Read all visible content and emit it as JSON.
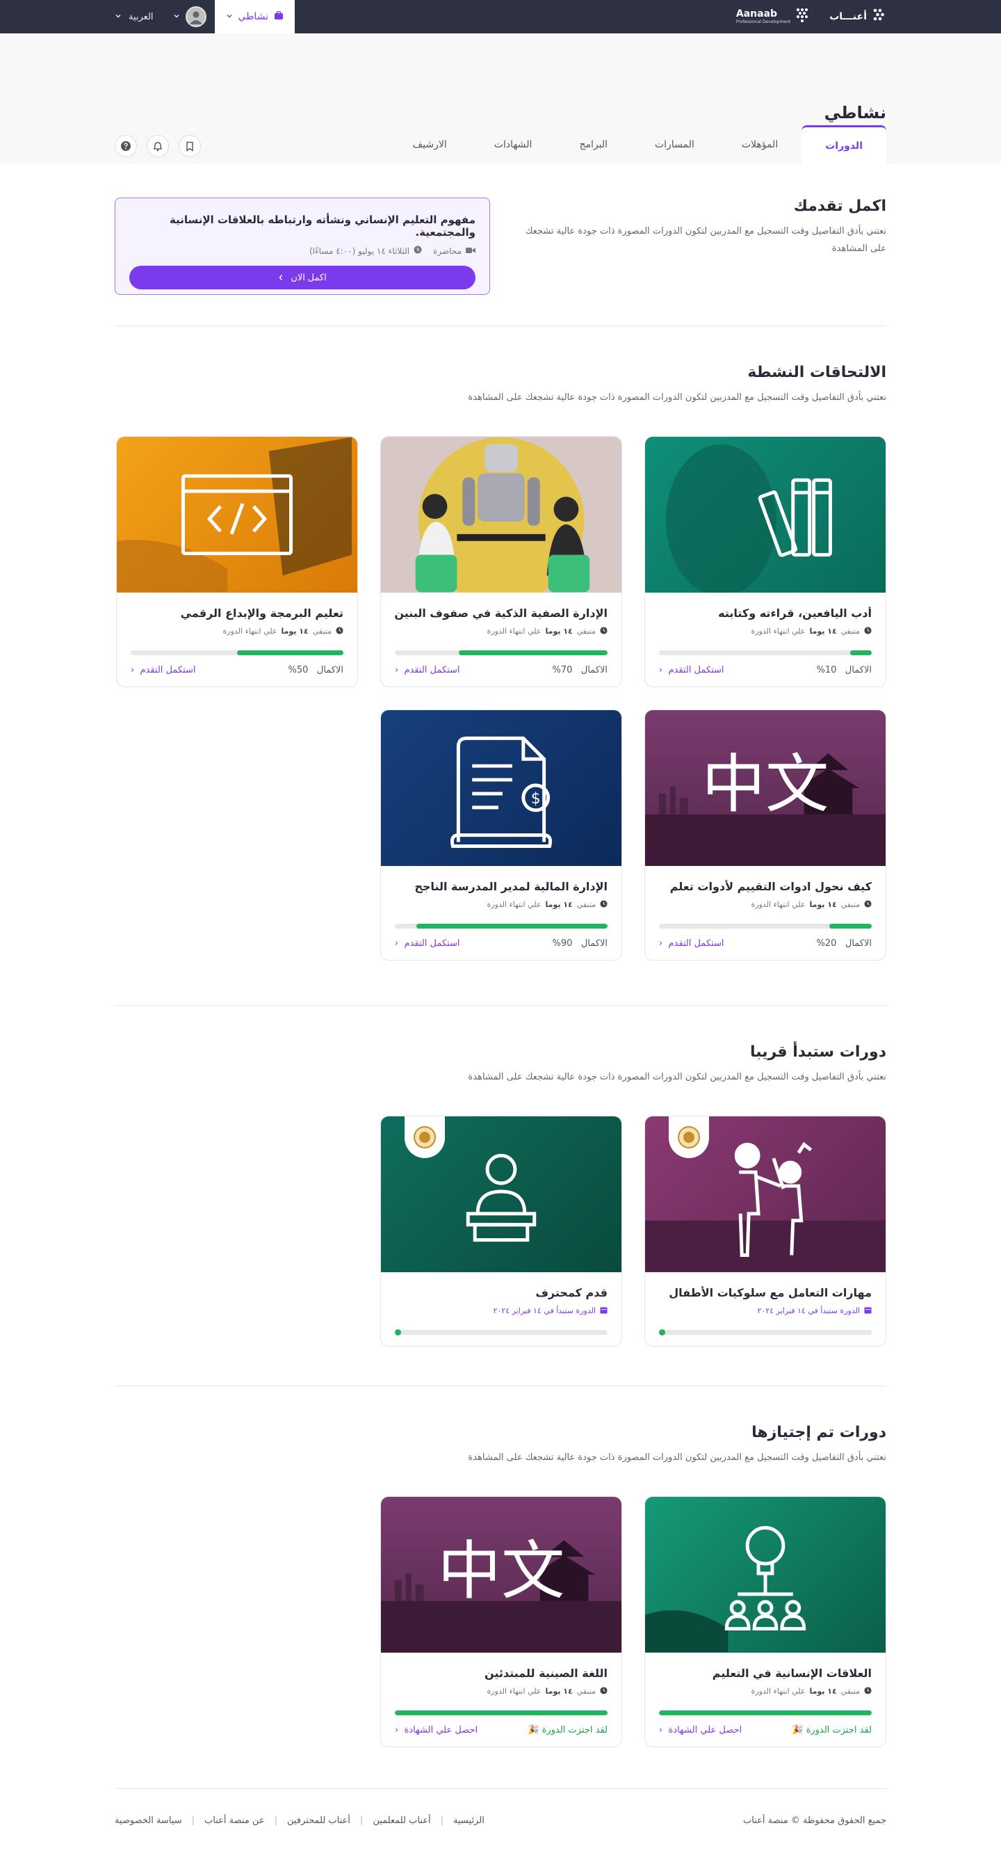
{
  "topbar": {
    "language": "العربية",
    "my_activity": "نشاطي",
    "brand_primary": "Aanaab",
    "brand_primary_sub": "Professional Development",
    "brand_secondary": "أعنـــاب"
  },
  "header": {
    "title": "نشاطي",
    "tabs": [
      "الدورات",
      "المؤهلات",
      "المسارات",
      "البرامج",
      "الشهادات",
      "الارشيف"
    ]
  },
  "progress": {
    "title": "اكمل تقدمك",
    "desc": "نعتني بأدق التفاصيل وقت التسجيل مع المدربين لتكون الدورات المصورة ذات جودة عالية تشجعك على المشاهدة",
    "card_title": "مفهوم التعليم الإنساني ونشأته وارتباطه بالعلاقات الإنسانية والمجتمعية.",
    "card_type": "محاضرة",
    "card_time": "الثلاثاء ١٤ يوليو (٤:٠٠ مساءًا)",
    "card_button": "اكمل الان"
  },
  "active": {
    "title": "الالتحاقات النشطة",
    "desc": "نعتني بأدق التفاصيل وقت التسجيل مع المدربين لتكون الدورات المصورة ذات جودة عالية تشجعك على المشاهدة",
    "remaining_prefix": "متبقي",
    "remaining_days": "١٤ يوما",
    "remaining_suffix": "علي انتهاء الدورة",
    "completion_label": "الاكمال",
    "continue_label": "استكمل التقدم",
    "courses": [
      {
        "title": "أدب اليافعين، قراءته وكتابته",
        "percent": "10%",
        "progress": 0.1
      },
      {
        "title": "الإدارة الصفية الذكية في صفوف البنين ...",
        "percent": "70%",
        "progress": 0.7
      },
      {
        "title": "تعليم البرمجة والإبداع الرقمي",
        "percent": "50%",
        "progress": 0.5
      },
      {
        "title": "كيف نحول ادوات التقييم لأدوات تعلم",
        "percent": "20%",
        "progress": 0.2
      },
      {
        "title": "الإدارة المالية لمدير المدرسة الناجح",
        "percent": "90%",
        "progress": 0.9
      }
    ]
  },
  "upcoming": {
    "title": "دورات ستبدأ قريبا",
    "desc": "نعتني بأدق التفاصيل وقت التسجيل مع المدربين لتكون الدورات المصورة ذات جودة عالية تشجعك على المشاهدة",
    "start_label": "الدورة ستبدأ في ١٤ فبراير ٢٠٢٤",
    "courses": [
      {
        "title": "مهارات التعامل مع سلوكيات الأطفال",
        "progress": 0.0
      },
      {
        "title": "قدم كمحترف",
        "progress": 0.0
      }
    ]
  },
  "passed": {
    "title": "دورات تم إجتيازها",
    "desc": "نعتني بأدق التفاصيل وقت التسجيل مع المدربين لتكون الدورات المصورة ذات جودة عالية تشجعك على المشاهدة",
    "passed_label": "لقد اجتزت الدورة",
    "certificate_label": "احصل علي الشهادة",
    "courses": [
      {
        "title": "العلاقات الإنسانية في التعليم",
        "progress": 1.0
      },
      {
        "title": "اللغة الصينية للمبتدئين",
        "progress": 1.0
      }
    ]
  },
  "image_text": {
    "chinese": "中文"
  },
  "footer": {
    "copyright": "جميع الحقوق محفوظة © منصة أعناب",
    "links": [
      "الرئيسية",
      "أعناب للمعلمين",
      "أعناب للمحترفين",
      "عن منصة أعناب",
      "سياسة الخصوصية"
    ]
  },
  "colors": {
    "accent": "#7c3aed",
    "progress": "#22b55e",
    "topbar": "#2d3142"
  }
}
